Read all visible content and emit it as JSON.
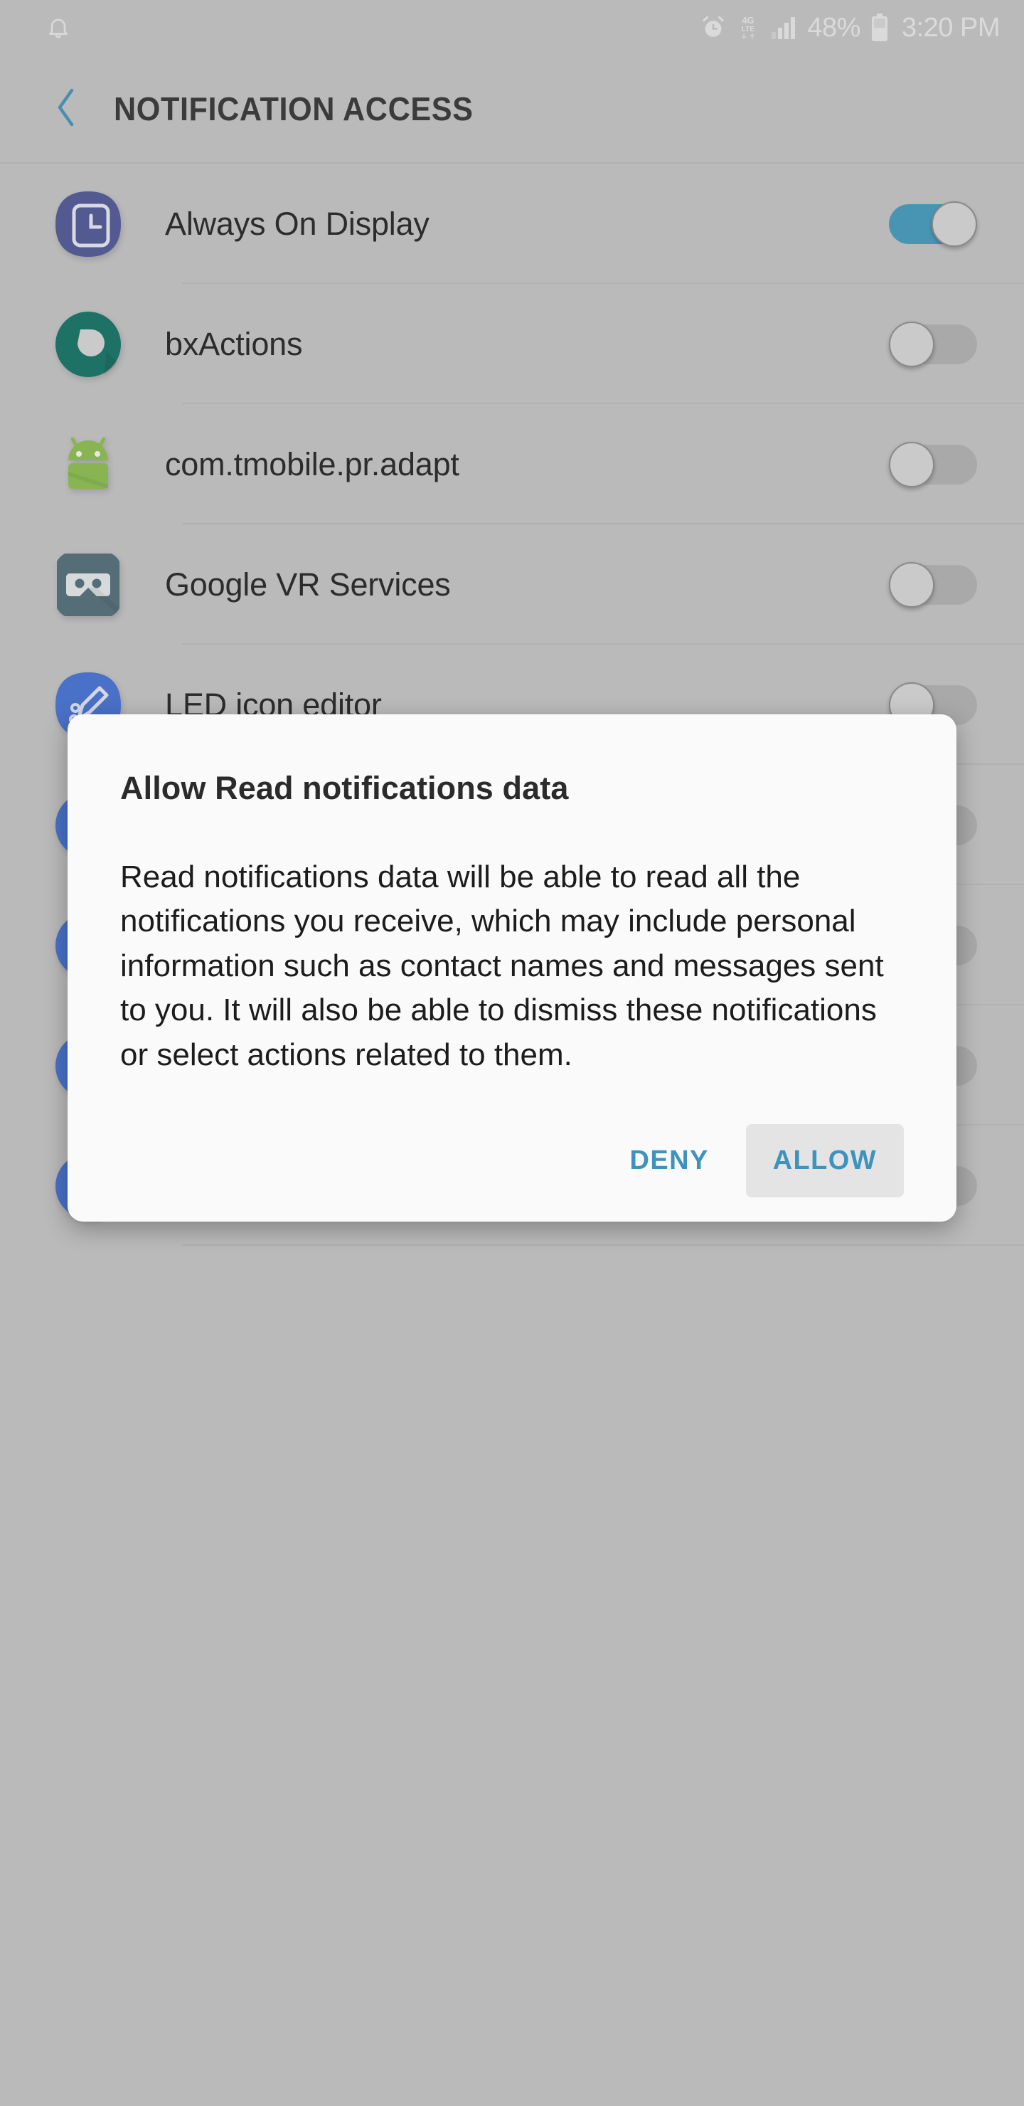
{
  "status_bar": {
    "notification_icon": "bell-icon",
    "alarm_icon": "alarm-clock-icon",
    "network_label": "4G",
    "network_sub_label": "LTE",
    "signal_icon": "signal-bars-icon",
    "battery_percent": "48%",
    "battery_icon": "battery-icon",
    "time": "3:20 PM"
  },
  "app_bar": {
    "back_icon": "back-chevron-icon",
    "title": "NOTIFICATION ACCESS"
  },
  "list": {
    "items": [
      {
        "label": "Always On Display",
        "icon": "always-on-display-icon",
        "toggle": "on"
      },
      {
        "label": "bxActions",
        "icon": "bxactions-icon",
        "toggle": "off"
      },
      {
        "label": "com.tmobile.pr.adapt",
        "icon": "android-robot-icon",
        "toggle": "off"
      },
      {
        "label": "Google VR Services",
        "icon": "google-vr-goggles-icon",
        "toggle": "off"
      },
      {
        "label": "LED icon editor",
        "icon": "led-icon-editor-icon",
        "toggle": "off"
      }
    ]
  },
  "dialog": {
    "title": "Allow Read notifications data",
    "message": "Read notifications data will be able to read all the notifications you receive, which may include personal information such as contact names and messages sent to you. It will also be able to dismiss these notifications or select actions related to them.",
    "deny_label": "DENY",
    "allow_label": "ALLOW"
  },
  "colors": {
    "background": "#c8c8c8",
    "accent_teal": "#3d93bd",
    "toggle_on_track": "#3d9cc0",
    "toggle_off_track": "#b4b4b4",
    "dialog_surface": "#fafafa",
    "title_text": "#2e2e2e"
  }
}
